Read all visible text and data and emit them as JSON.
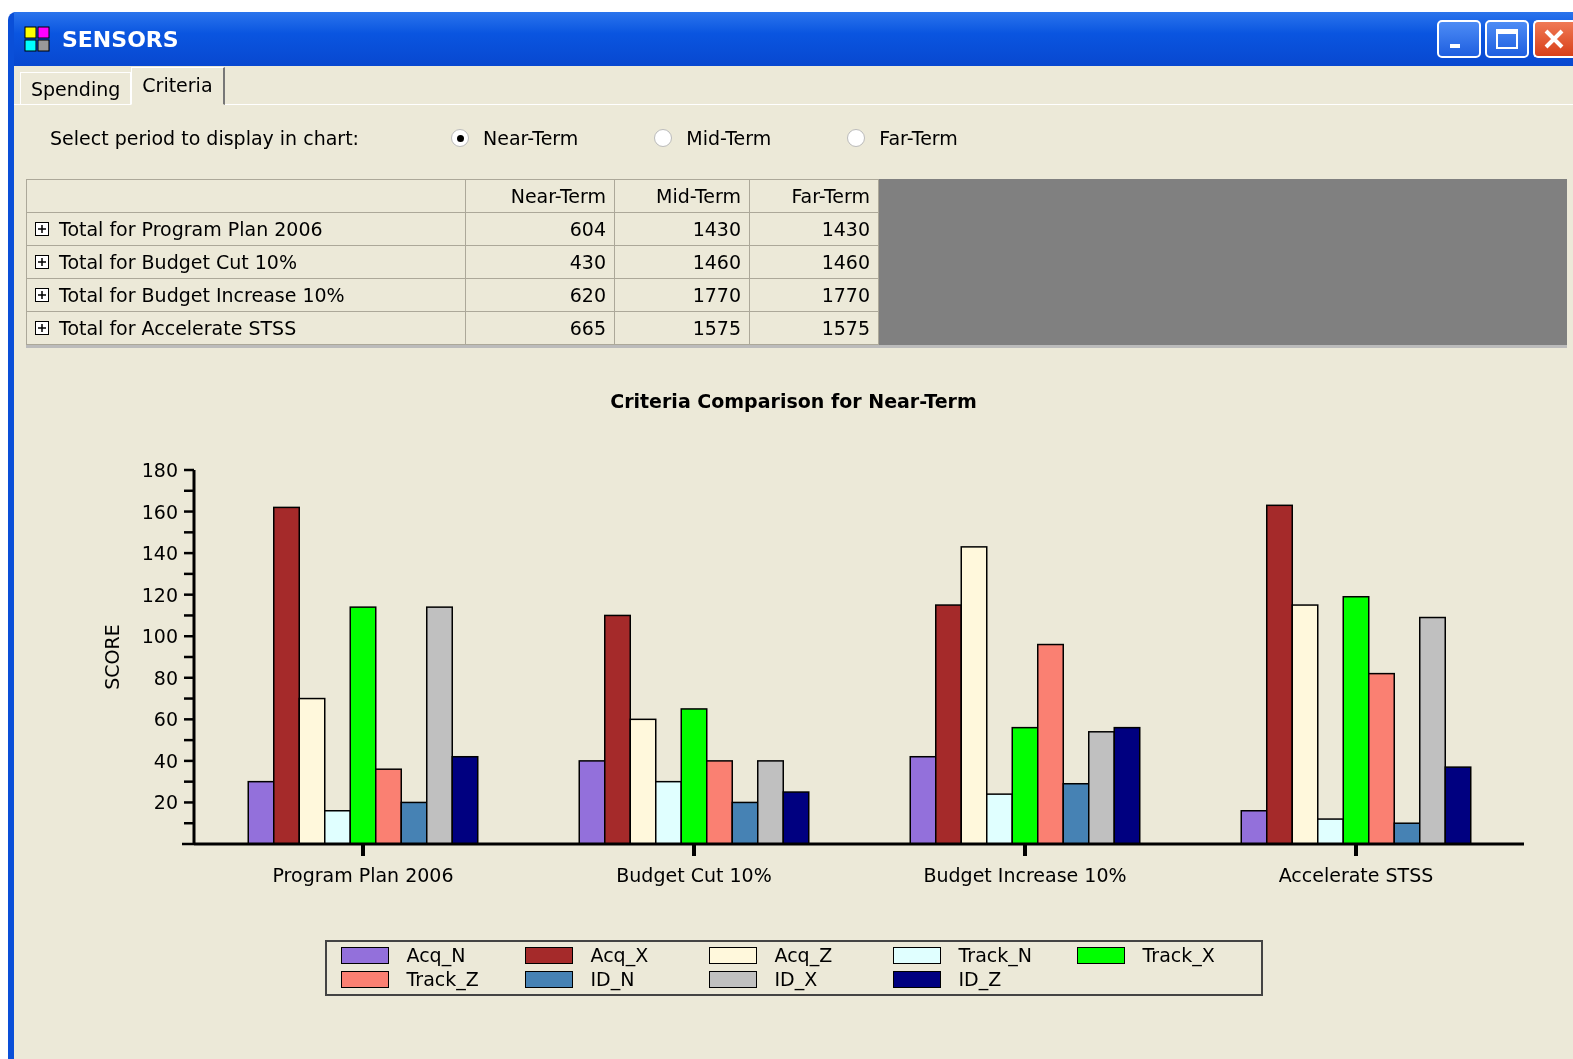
{
  "window": {
    "title": "SENSORS"
  },
  "tabs": [
    {
      "label": "Spending",
      "selected": false
    },
    {
      "label": "Criteria",
      "selected": true
    }
  ],
  "period": {
    "label": "Select period to display in chart:",
    "options": [
      {
        "label": "Near-Term",
        "selected": true
      },
      {
        "label": "Mid-Term",
        "selected": false
      },
      {
        "label": "Far-Term",
        "selected": false
      }
    ]
  },
  "table": {
    "columns": [
      "Near-Term",
      "Mid-Term",
      "Far-Term"
    ],
    "rows": [
      {
        "label": "Total for Program Plan 2006",
        "expanded": false,
        "values": [
          "604",
          "1430",
          "1430"
        ]
      },
      {
        "label": "Total for Budget Cut 10%",
        "expanded": false,
        "values": [
          "430",
          "1460",
          "1460"
        ]
      },
      {
        "label": "Total for Budget Increase 10%",
        "expanded": false,
        "values": [
          "620",
          "1770",
          "1770"
        ]
      },
      {
        "label": "Total for Accelerate STSS",
        "expanded": false,
        "values": [
          "665",
          "1575",
          "1575"
        ]
      }
    ]
  },
  "chart": {
    "chart_data": {
      "type": "bar",
      "legend": "bottom",
      "title": "Criteria Comparison for Near-Term",
      "ylabel": "SCORE",
      "categories": [
        "Program Plan 2006",
        "Budget Cut 10%",
        "Budget Increase 10%",
        "Accelerate STSS"
      ],
      "ylim": [
        0,
        180
      ],
      "yticks": [
        20,
        40,
        60,
        80,
        100,
        120,
        140,
        160,
        180
      ],
      "series": [
        {
          "name": "Acq_N",
          "color": "#9370db",
          "values": [
            30,
            40,
            42,
            16
          ]
        },
        {
          "name": "Acq_X",
          "color": "#a52a2a",
          "values": [
            162,
            110,
            115,
            163
          ]
        },
        {
          "name": "Acq_Z",
          "color": "#fff8dc",
          "values": [
            70,
            60,
            143,
            115
          ]
        },
        {
          "name": "Track_N",
          "color": "#e0ffff",
          "values": [
            16,
            30,
            24,
            12
          ]
        },
        {
          "name": "Track_X",
          "color": "#00ff00",
          "values": [
            114,
            65,
            56,
            119
          ]
        },
        {
          "name": "Track_Z",
          "color": "#fa8072",
          "values": [
            36,
            40,
            96,
            82
          ]
        },
        {
          "name": "ID_N",
          "color": "#4682b4",
          "values": [
            20,
            20,
            29,
            10
          ]
        },
        {
          "name": "ID_X",
          "color": "#c0c0c0",
          "values": [
            114,
            40,
            54,
            109
          ]
        },
        {
          "name": "ID_Z",
          "color": "#000080",
          "values": [
            42,
            25,
            56,
            37
          ]
        }
      ]
    }
  }
}
